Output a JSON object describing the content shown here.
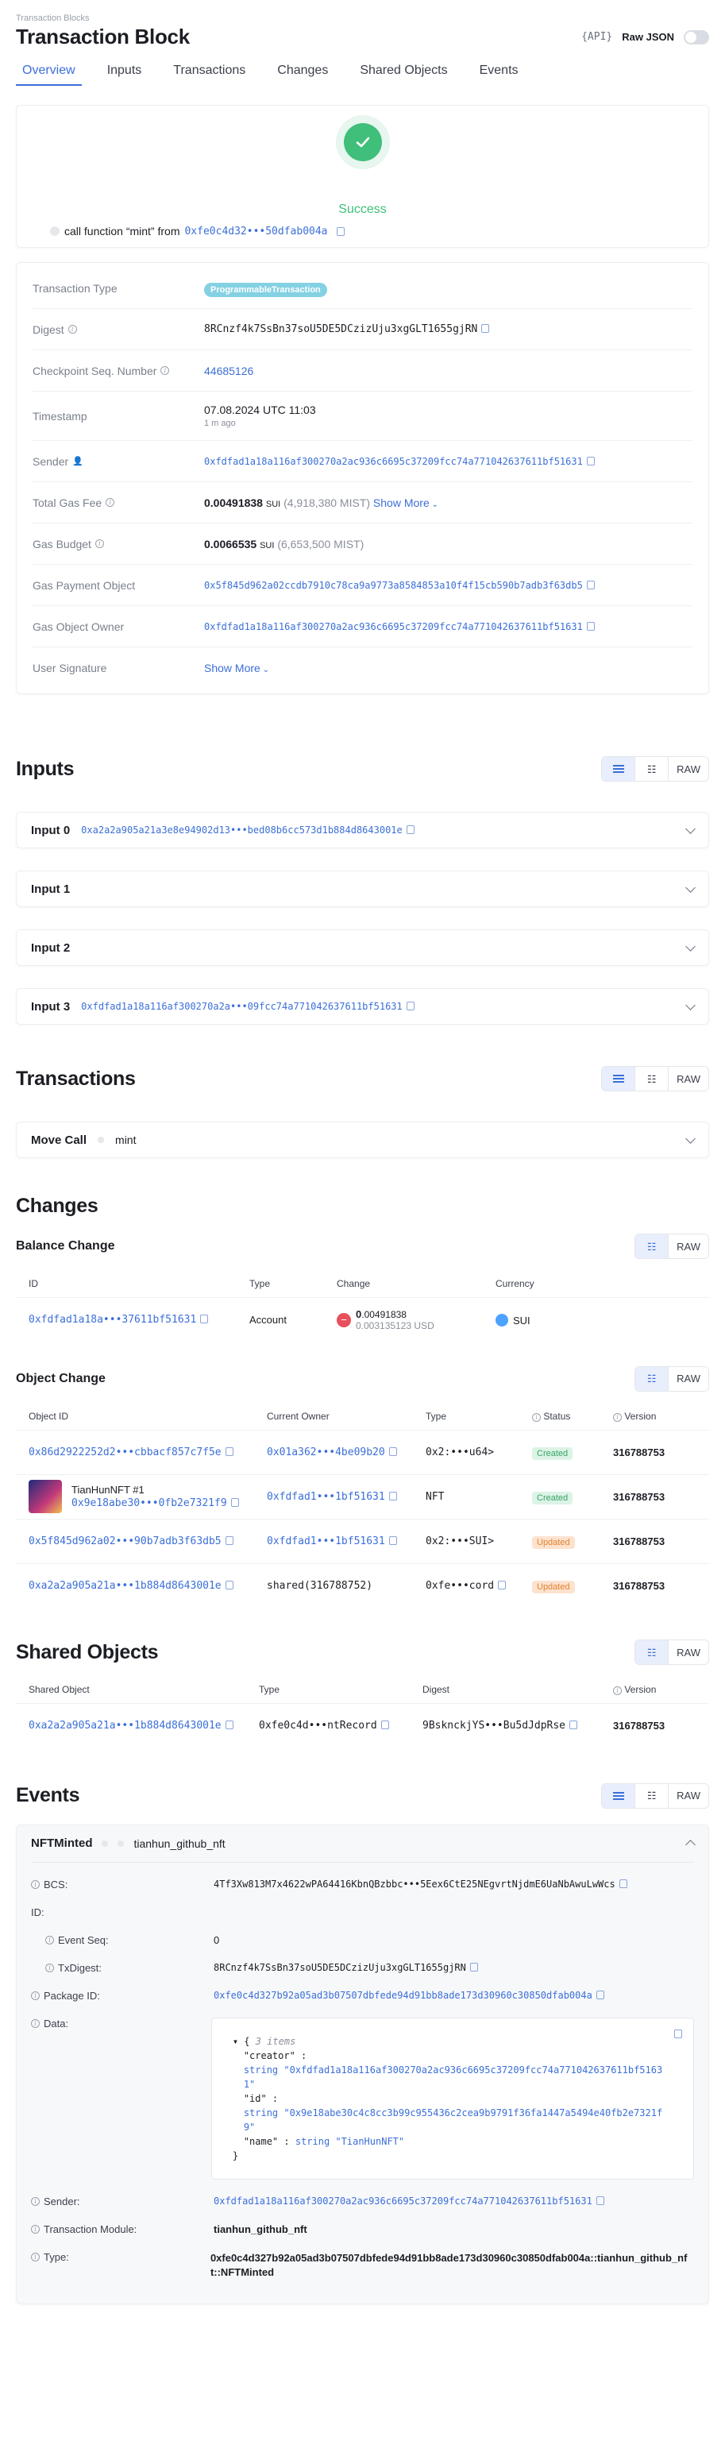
{
  "breadcrumb": "Transaction Blocks",
  "page_title": "Transaction Block",
  "api_label": "{API}",
  "raw_json_label": "Raw JSON",
  "tabs": [
    "Overview",
    "Inputs",
    "Transactions",
    "Changes",
    "Shared Objects",
    "Events"
  ],
  "status": {
    "text": "Success",
    "call_prefix": "call function “mint” from",
    "call_package": "0xfe0c4d32•••50dfab004a"
  },
  "details": {
    "tx_type_label": "Transaction Type",
    "tx_type": "ProgrammableTransaction",
    "digest_label": "Digest",
    "digest": "8RCnzf4k7SsBn37soU5DE5DCzizUju3xgGLT1655gjRN",
    "checkpoint_label": "Checkpoint Seq. Number",
    "checkpoint": "44685126",
    "timestamp_label": "Timestamp",
    "timestamp": "07.08.2024 UTC 11:03",
    "timestamp_ago": "1 m ago",
    "sender_label": "Sender",
    "sender": "0xfdfad1a18a116af300270a2ac936c6695c37209fcc74a771042637611bf51631",
    "gas_fee_label": "Total Gas Fee",
    "gas_fee": "0.00491838",
    "gas_fee_unit": "SUI",
    "gas_fee_mist": "(4,918,380 MIST)",
    "show_more": "Show More",
    "gas_budget_label": "Gas Budget",
    "gas_budget": "0.0066535",
    "gas_budget_unit": "SUI",
    "gas_budget_mist": "(6,653,500 MIST)",
    "gas_payment_label": "Gas Payment Object",
    "gas_payment": "0x5f845d962a02ccdb7910c78ca9a9773a8584853a10f4f15cb590b7adb3f63db5",
    "gas_owner_label": "Gas Object Owner",
    "gas_owner": "0xfdfad1a18a116af300270a2ac936c6695c37209fcc74a771042637611bf51631",
    "signature_label": "User Signature"
  },
  "view_buttons": {
    "raw": "RAW"
  },
  "inputs": {
    "title": "Inputs",
    "items": [
      {
        "label": "Input 0",
        "value": "0xa2a2a905a21a3e8e94902d13•••bed08b6cc573d1b884d8643001e"
      },
      {
        "label": "Input 1",
        "value": ""
      },
      {
        "label": "Input 2",
        "value": ""
      },
      {
        "label": "Input 3",
        "value": "0xfdfad1a18a116af300270a2a•••09fcc74a771042637611bf51631"
      }
    ]
  },
  "transactions": {
    "title": "Transactions",
    "call_label": "Move Call",
    "call_fn": "mint"
  },
  "changes": {
    "title": "Changes",
    "balance": {
      "title": "Balance Change",
      "headers": [
        "ID",
        "Type",
        "Change",
        "Currency"
      ],
      "row": {
        "id": "0xfdfad1a18a•••37611bf51631",
        "type": "Account",
        "change": "0.00491838",
        "change_int": "0",
        "change_dec": ".00491838",
        "usd": "0.003135123",
        "usd_unit": "USD",
        "currency": "SUI"
      }
    },
    "object": {
      "title": "Object Change",
      "headers": [
        "Object ID",
        "Current Owner",
        "Type",
        "Status",
        "Version"
      ],
      "rows": [
        {
          "id": "0x86d2922252d2•••cbbacf857c7f5e",
          "owner": "0x01a362•••4be09b20",
          "type": "0x2:•••u64>",
          "status": "Created",
          "version": "316788753"
        },
        {
          "name": "TianHunNFT #1",
          "id": "0x9e18abe30•••0fb2e7321f9",
          "owner": "0xfdfad1•••1bf51631",
          "type": "NFT",
          "status": "Created",
          "version": "316788753"
        },
        {
          "id": "0x5f845d962a02•••90b7adb3f63db5",
          "owner": "0xfdfad1•••1bf51631",
          "type": "0x2:•••SUI>",
          "status": "Updated",
          "version": "316788753"
        },
        {
          "id": "0xa2a2a905a21a•••1b884d8643001e",
          "owner": "shared(316788752)",
          "type": "0xfe•••cord",
          "status": "Updated",
          "version": "316788753"
        }
      ]
    }
  },
  "shared": {
    "title": "Shared Objects",
    "headers": [
      "Shared Object",
      "Type",
      "Digest",
      "Version"
    ],
    "row": {
      "object": "0xa2a2a905a21a•••1b884d8643001e",
      "type": "0xfe0c4d•••ntRecord",
      "digest": "9BsknckjYS•••Bu5dJdpRse",
      "version": "316788753"
    }
  },
  "events": {
    "title": "Events",
    "event_name": "NFTMinted",
    "module": "tianhun_github_nft",
    "bcs_label": "BCS:",
    "bcs": "4Tf3Xw813M7x4622wPA64416KbnQBzbbc•••5Eex6CtE25NEgvrtNjdmE6UaNbAwuLwWcs",
    "id_label": "ID:",
    "event_seq_label": "Event Seq:",
    "event_seq": "0",
    "txdigest_label": "TxDigest:",
    "txdigest": "8RCnzf4k7SsBn37soU5DE5DCzizUju3xgGLT1655gjRN",
    "package_label": "Package ID:",
    "package": "0xfe0c4d327b92a05ad3b07507dbfede94d91bb8ade173d30960c30850dfab004a",
    "data_label": "Data:",
    "json_count": "3 items",
    "json_creator_key": "\"creator\" :",
    "json_creator_val": "string \"0xfdfad1a18a116af300270a2ac936c6695c37209fcc74a771042637611bf51631\"",
    "json_id_key": "\"id\" :",
    "json_id_val": "string \"0x9e18abe30c4c8cc3b99c955436c2cea9b9791f36fa1447a5494e40fb2e7321f9\"",
    "json_name_key": "\"name\" :",
    "json_name_val": "string \"TianHunNFT\"",
    "sender_label": "Sender:",
    "sender": "0xfdfad1a18a116af300270a2ac936c6695c37209fcc74a771042637611bf51631",
    "txmodule_label": "Transaction Module:",
    "txmodule": "tianhun_github_nft",
    "type_label": "Type:",
    "type": "0xfe0c4d327b92a05ad3b07507dbfede94d91bb8ade173d30960c30850dfab004a::tianhun_github_nft::NFTMinted"
  },
  "colors": {
    "accent": "#3b6fd8",
    "success": "#3fbf7a",
    "updated": "#e0832f"
  }
}
